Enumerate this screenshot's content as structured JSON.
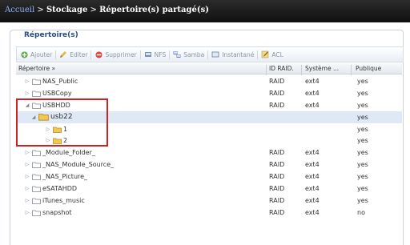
{
  "breadcrumb": {
    "home": "Accueil",
    "sep1": " > ",
    "storage": "Stockage",
    "sep2": " > ",
    "current": "Répertoire(s) partagé(s)"
  },
  "panel": {
    "title": "Répertoire(s)"
  },
  "toolbar": {
    "add": "Ajouter",
    "edit": "Editer",
    "delete": "Supprimer",
    "nfs": "NFS",
    "samba": "Samba",
    "snapshot": "Instantané",
    "acl": "ACL"
  },
  "columns": {
    "directory": "Répertoire »",
    "raid": "ID RAID.",
    "fs": "Système ...",
    "public": "Publique"
  },
  "rows": [
    {
      "name": "NAS_Public",
      "raid": "RAID",
      "fs": "ext4",
      "public": "yes"
    },
    {
      "name": "USBCopy",
      "raid": "RAID",
      "fs": "ext4",
      "public": "yes"
    },
    {
      "name": "USBHDD",
      "raid": "RAID",
      "fs": "ext4",
      "public": "yes"
    },
    {
      "name": "usb22",
      "raid": "",
      "fs": "",
      "public": "yes"
    },
    {
      "name": "1",
      "raid": "",
      "fs": "",
      "public": "yes"
    },
    {
      "name": "2",
      "raid": "",
      "fs": "",
      "public": "yes"
    },
    {
      "name": "_Module_Folder_",
      "raid": "RAID",
      "fs": "ext4",
      "public": "yes"
    },
    {
      "name": "_NAS_Module_Source_",
      "raid": "RAID",
      "fs": "ext4",
      "public": "yes"
    },
    {
      "name": "_NAS_Picture_",
      "raid": "RAID",
      "fs": "ext4",
      "public": "yes"
    },
    {
      "name": "eSATAHDD",
      "raid": "RAID",
      "fs": "ext4",
      "public": "yes"
    },
    {
      "name": "iTunes_music",
      "raid": "RAID",
      "fs": "ext4",
      "public": "yes"
    },
    {
      "name": "snapshot",
      "raid": "RAID",
      "fs": "ext4",
      "public": "no"
    }
  ],
  "colors": {
    "highlight_box": "#cc2222",
    "selected_row": "#dfe8f6",
    "folder": "#f2c94c"
  }
}
